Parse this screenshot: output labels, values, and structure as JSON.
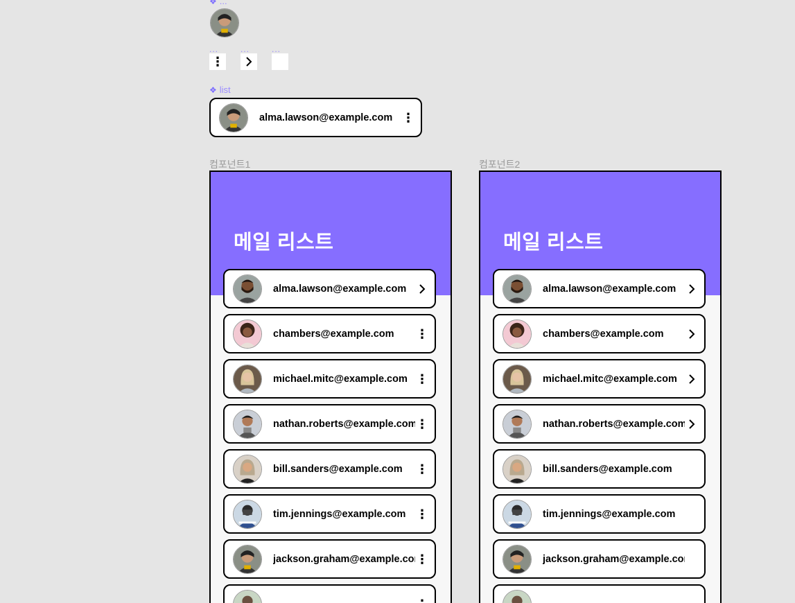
{
  "components": {
    "avatar_label": "...",
    "kebab_label": "...",
    "chevron_label": "...",
    "empty_label": "...",
    "list_label": "list",
    "list_preview": {
      "email": "alma.lawson@example.com",
      "trailing": "kebab"
    }
  },
  "frames": [
    {
      "label": "컴포넌트1",
      "title": "메일 리스트",
      "items": [
        {
          "email": "alma.lawson@example.com",
          "trailing": "chevron",
          "avatar": "man-beard"
        },
        {
          "email": "chambers@example.com",
          "trailing": "kebab",
          "avatar": "woman-curly-pink"
        },
        {
          "email": "michael.mitc@example.com",
          "trailing": "kebab",
          "avatar": "woman-blonde"
        },
        {
          "email": "nathan.roberts@example.com",
          "trailing": "kebab",
          "avatar": "man-scarf"
        },
        {
          "email": "bill.sanders@example.com",
          "trailing": "kebab",
          "avatar": "woman-grey-hair"
        },
        {
          "email": "tim.jennings@example.com",
          "trailing": "kebab",
          "avatar": "person-camera"
        },
        {
          "email": "jackson.graham@example.con",
          "trailing": "kebab",
          "avatar": "woman-glasses"
        },
        {
          "email": "",
          "trailing": "kebab",
          "avatar": "partial"
        }
      ]
    },
    {
      "label": "컴포넌트2",
      "title": "메일 리스트",
      "items": [
        {
          "email": "alma.lawson@example.com",
          "trailing": "chevron",
          "avatar": "man-beard"
        },
        {
          "email": "chambers@example.com",
          "trailing": "chevron",
          "avatar": "woman-curly-pink"
        },
        {
          "email": "michael.mitc@example.com",
          "trailing": "chevron",
          "avatar": "woman-blonde"
        },
        {
          "email": "nathan.roberts@example.com",
          "trailing": "chevron",
          "avatar": "man-scarf"
        },
        {
          "email": "bill.sanders@example.com",
          "trailing": "none",
          "avatar": "woman-grey-hair"
        },
        {
          "email": "tim.jennings@example.com",
          "trailing": "none",
          "avatar": "person-camera"
        },
        {
          "email": "jackson.graham@example.con",
          "trailing": "none",
          "avatar": "woman-glasses"
        },
        {
          "email": "",
          "trailing": "none",
          "avatar": "partial"
        }
      ]
    }
  ],
  "colors": {
    "header": "#866eff",
    "accent": "#9b8cff",
    "canvas": "#e5e5e5",
    "panel": "#f7f7f7"
  }
}
